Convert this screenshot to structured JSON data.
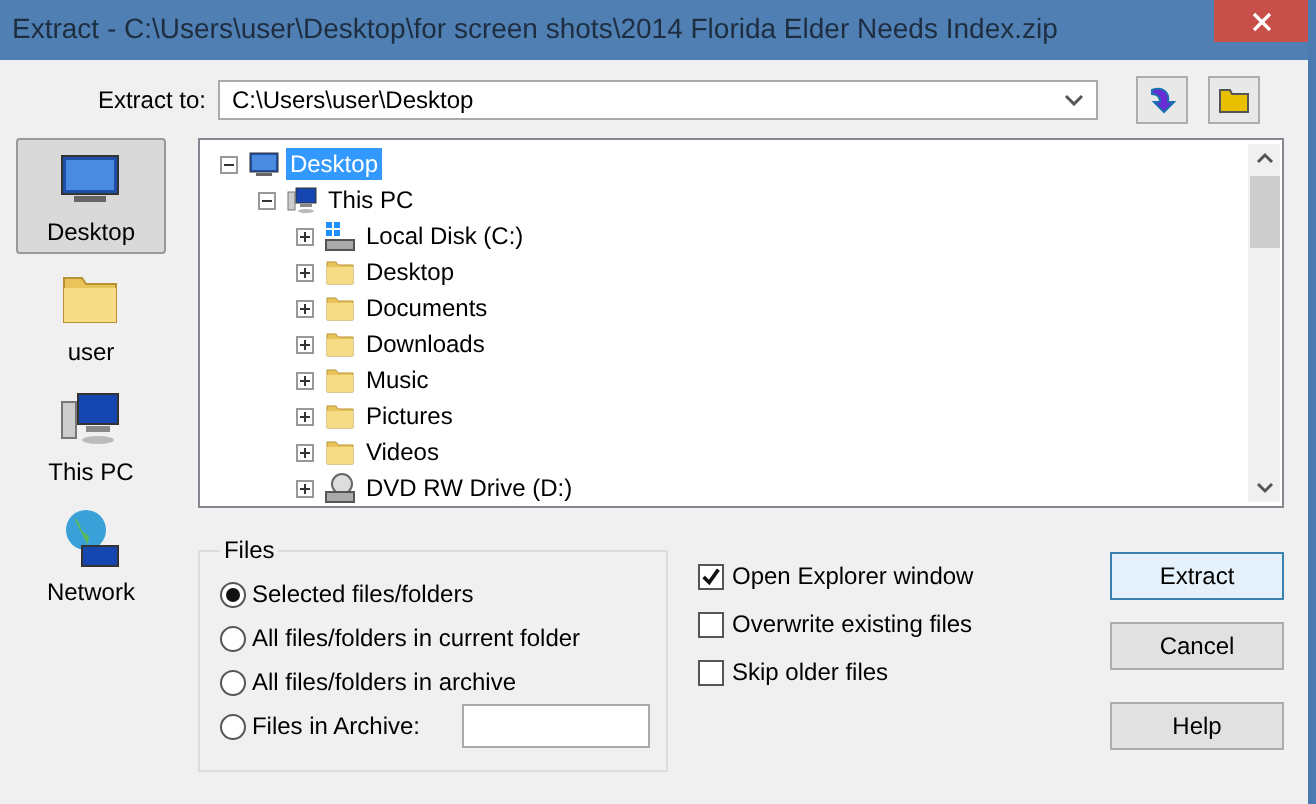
{
  "window": {
    "title": "Extract - C:\\Users\\user\\Desktop\\for screen shots\\2014 Florida Elder Needs Index.zip"
  },
  "destination": {
    "label": "Extract to:",
    "value": "C:\\Users\\user\\Desktop"
  },
  "places": [
    {
      "label": "Desktop",
      "kind": "desktop",
      "selected": true
    },
    {
      "label": "user",
      "kind": "folder",
      "selected": false
    },
    {
      "label": "This PC",
      "kind": "pc",
      "selected": false
    },
    {
      "label": "Network",
      "kind": "network",
      "selected": false
    }
  ],
  "tree": {
    "items": [
      {
        "label": "Desktop",
        "kind": "desktop",
        "selected": true,
        "expanded": true,
        "children": [
          {
            "label": "This PC",
            "kind": "pc",
            "selected": false,
            "expanded": true,
            "children": [
              {
                "label": "Local Disk (C:)",
                "kind": "drive",
                "selected": false,
                "expanded": false
              },
              {
                "label": "Desktop",
                "kind": "folder",
                "selected": false,
                "expanded": false
              },
              {
                "label": "Documents",
                "kind": "folder",
                "selected": false,
                "expanded": false
              },
              {
                "label": "Downloads",
                "kind": "folder",
                "selected": false,
                "expanded": false
              },
              {
                "label": "Music",
                "kind": "folder",
                "selected": false,
                "expanded": false
              },
              {
                "label": "Pictures",
                "kind": "folder",
                "selected": false,
                "expanded": false
              },
              {
                "label": "Videos",
                "kind": "folder",
                "selected": false,
                "expanded": false
              },
              {
                "label": "DVD RW Drive (D:)",
                "kind": "optical",
                "selected": false,
                "expanded": false
              }
            ]
          }
        ]
      }
    ]
  },
  "files": {
    "title": "Files",
    "options": [
      {
        "label": "Selected files/folders",
        "kind": "radio",
        "selected": true
      },
      {
        "label": "All files/folders in current folder",
        "kind": "radio",
        "selected": false
      },
      {
        "label": "All files/folders in archive",
        "kind": "radio",
        "selected": false
      },
      {
        "label": "Files in Archive:",
        "kind": "radio_with_field",
        "selected": false
      }
    ]
  },
  "options": [
    {
      "label": "Open Explorer window",
      "checked": true
    },
    {
      "label": "Overwrite existing files",
      "checked": false
    },
    {
      "label": "Skip older files",
      "checked": false
    }
  ],
  "buttons": [
    {
      "label": "Extract",
      "default": true
    },
    {
      "label": "Cancel",
      "default": false
    },
    {
      "label": "Help",
      "default": false
    }
  ]
}
